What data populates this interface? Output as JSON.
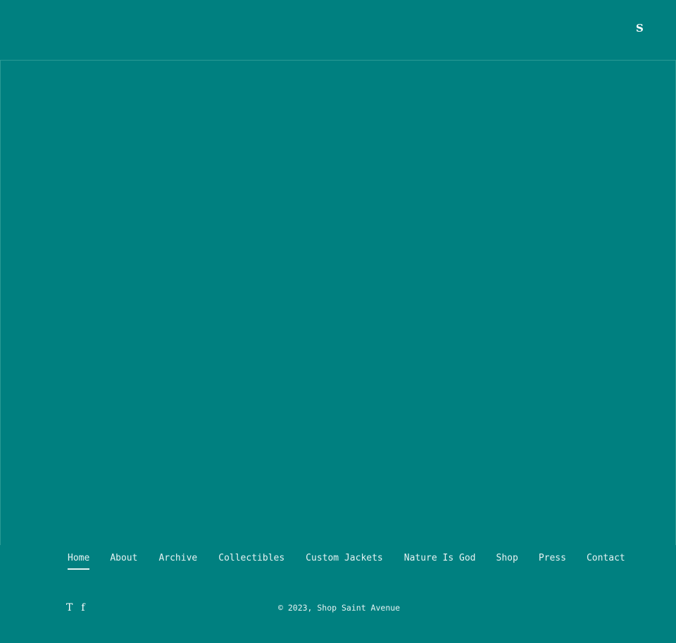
{
  "header": {
    "icon": {
      "name": "shopify-s-icon",
      "glyph": "S"
    }
  },
  "footer": {
    "nav": [
      {
        "label": "Home",
        "active": true
      },
      {
        "label": "About",
        "active": false
      },
      {
        "label": "Archive",
        "active": false
      },
      {
        "label": "Collectibles",
        "active": false
      },
      {
        "label": "Custom Jackets",
        "active": false
      },
      {
        "label": "Nature Is God",
        "active": false
      },
      {
        "label": "Shop",
        "active": false
      },
      {
        "label": "Press",
        "active": false
      },
      {
        "label": "Contact",
        "active": false
      }
    ],
    "social": [
      {
        "name": "twitter-icon",
        "glyph": "T"
      },
      {
        "name": "facebook-icon",
        "glyph": "f"
      }
    ],
    "copyright": "© 2023, Shop Saint Avenue"
  },
  "colors": {
    "background": "#008080",
    "text": "#e6f3f3"
  }
}
